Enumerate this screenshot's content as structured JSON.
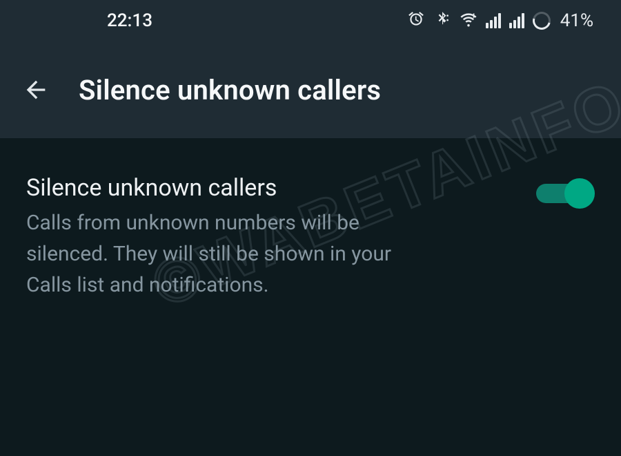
{
  "status_bar": {
    "time": "22:13",
    "battery_percent": "41%"
  },
  "header": {
    "title": "Silence unknown callers"
  },
  "setting": {
    "title": "Silence unknown callers",
    "description": "Calls from unknown numbers will be silenced. They will still be shown in your Calls list and notifications.",
    "enabled": true
  },
  "watermark": "©WABETAINFO"
}
